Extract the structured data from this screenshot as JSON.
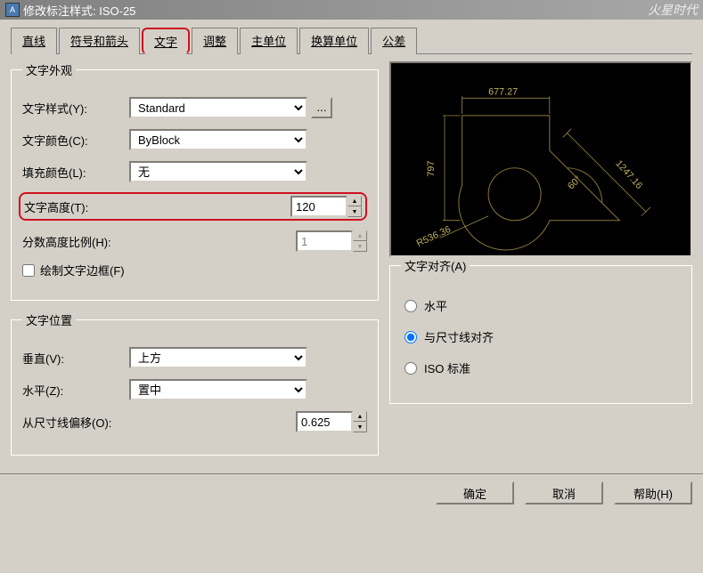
{
  "titlebar": {
    "title": "修改标注样式: ISO-25",
    "watermark": "火星时代"
  },
  "tabs": {
    "line": "直线",
    "symbols": "符号和箭头",
    "text": "文字",
    "fit": "调整",
    "primary": "主单位",
    "alternate": "换算单位",
    "tolerance": "公差"
  },
  "appearance": {
    "legend": "文字外观",
    "style_label": "文字样式(Y):",
    "style_value": "Standard",
    "more": "...",
    "color_label": "文字颜色(C):",
    "color_value": "ByBlock",
    "fill_label": "填充颜色(L):",
    "fill_value": "无",
    "height_label": "文字高度(T):",
    "height_value": "120",
    "fraction_label": "分数高度比例(H):",
    "fraction_value": "1",
    "frame_label": "绘制文字边框(F)"
  },
  "placement": {
    "legend": "文字位置",
    "vertical_label": "垂直(V):",
    "vertical_value": "上方",
    "horizontal_label": "水平(Z):",
    "horizontal_value": "置中",
    "offset_label": "从尺寸线偏移(O):",
    "offset_value": "0.625"
  },
  "alignment": {
    "legend": "文字对齐(A)",
    "horizontal": "水平",
    "aligned": "与尺寸线对齐",
    "iso": "ISO 标准"
  },
  "preview": {
    "dim_top": "677.27",
    "dim_left": "797",
    "dim_radius": "R536.36",
    "dim_angle": "60°",
    "dim_diag": "1247.16"
  },
  "buttons": {
    "ok": "确定",
    "cancel": "取消",
    "help": "帮助(H)"
  }
}
